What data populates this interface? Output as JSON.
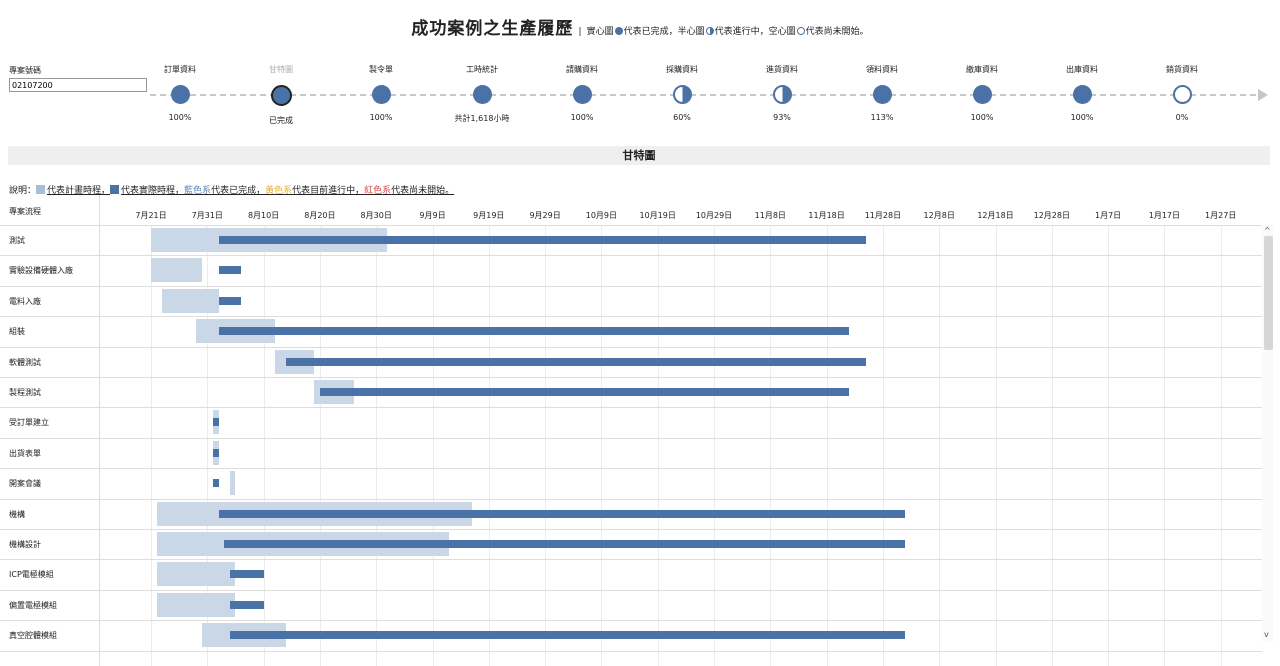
{
  "header": {
    "title": "成功案例之生產履歷",
    "desc_sep": "|",
    "desc_a": "實心圖",
    "desc_b": "代表已完成，半心圖",
    "desc_c": "代表進行中，空心圖",
    "desc_d": "代表尚未開始。"
  },
  "case": {
    "label": "專案號碼",
    "value": "02107200"
  },
  "pipeline": {
    "stages": [
      {
        "label": "訂單資料",
        "value": "100%",
        "state": "full"
      },
      {
        "label": "甘特圖",
        "value": "已完成",
        "state": "selected"
      },
      {
        "label": "製令單",
        "value": "100%",
        "state": "full"
      },
      {
        "label": "工時統計",
        "value": "共計1,618小時",
        "state": "full"
      },
      {
        "label": "請購資料",
        "value": "100%",
        "state": "full"
      },
      {
        "label": "採購資料",
        "value": "60%",
        "state": "half"
      },
      {
        "label": "進貨資料",
        "value": "93%",
        "state": "half"
      },
      {
        "label": "領料資料",
        "value": "113%",
        "state": "full"
      },
      {
        "label": "繳庫資料",
        "value": "100%",
        "state": "full"
      },
      {
        "label": "出庫資料",
        "value": "100%",
        "state": "full"
      },
      {
        "label": "銷貨資料",
        "value": "0%",
        "state": "empty"
      }
    ]
  },
  "gantt": {
    "title": "甘特圖",
    "legend": {
      "prefix": "說明：",
      "plan": "代表計畫時程，",
      "actual": "代表實際時程，",
      "blue": "藍色系",
      "done": "代表已完成，",
      "yellow": "黃色系",
      "progress": "代表目前進行中，",
      "red": "紅色系",
      "notstarted": "代表尚未開始。"
    },
    "task_header": "專案流程",
    "dates": [
      "7月21日",
      "7月31日",
      "8月10日",
      "8月20日",
      "8月30日",
      "9月9日",
      "9月19日",
      "9月29日",
      "10月9日",
      "10月19日",
      "10月29日",
      "11月8日",
      "11月18日",
      "11月28日",
      "12月8日",
      "12月18日",
      "12月28日",
      "1月7日",
      "1月17日",
      "1月27日"
    ],
    "tasks": [
      {
        "name": "測試",
        "plan": [
          "7月21日",
          "9月1日"
        ],
        "actual": [
          "8月2日",
          "11月25日"
        ]
      },
      {
        "name": "實驗設備硬體入廠",
        "plan": [
          "7月21日",
          "7月30日"
        ],
        "actual": [
          "8月2日",
          "8月6日"
        ]
      },
      {
        "name": "電料入廠",
        "plan": [
          "7月23日",
          "8月2日"
        ],
        "actual": [
          "8月2日",
          "8月6日"
        ]
      },
      {
        "name": "組裝",
        "plan": [
          "7月29日",
          "8月12日"
        ],
        "actual": [
          "8月2日",
          "11月22日"
        ]
      },
      {
        "name": "軟體測試",
        "plan": [
          "8月12日",
          "8月19日"
        ],
        "actual": [
          "8月14日",
          "11月25日"
        ]
      },
      {
        "name": "製程測試",
        "plan": [
          "8月19日",
          "8月26日"
        ],
        "actual": [
          "8月20日",
          "11月22日"
        ]
      },
      {
        "name": "受訂單建立",
        "plan": [
          "8月1日",
          "8月2日"
        ],
        "actual": [
          "8月1日",
          "8月2日"
        ]
      },
      {
        "name": "出貨表單",
        "plan": [
          "8月1日",
          "8月2日"
        ],
        "actual": [
          "8月1日",
          "8月2日"
        ]
      },
      {
        "name": "開案會議",
        "plan": [
          "8月4日",
          "8月5日"
        ],
        "actual": [
          "8月1日",
          "8月2日"
        ]
      },
      {
        "name": "機構",
        "plan": [
          "7月22日",
          "9月16日"
        ],
        "actual": [
          "8月2日",
          "12月2日"
        ]
      },
      {
        "name": "機構設計",
        "plan": [
          "7月22日",
          "9月12日"
        ],
        "actual": [
          "8月3日",
          "12月2日"
        ]
      },
      {
        "name": "ICP電極模組",
        "plan": [
          "7月22日",
          "8月5日"
        ],
        "actual": [
          "8月4日",
          "8月10日"
        ]
      },
      {
        "name": "偏置電極模組",
        "plan": [
          "7月22日",
          "8月5日"
        ],
        "actual": [
          "8月4日",
          "8月10日"
        ]
      },
      {
        "name": "真空腔體模組",
        "plan": [
          "7月30日",
          "8月14日"
        ],
        "actual": [
          "8月4日",
          "12月2日"
        ]
      }
    ]
  },
  "scroll": {
    "up": "^",
    "down": "v"
  }
}
